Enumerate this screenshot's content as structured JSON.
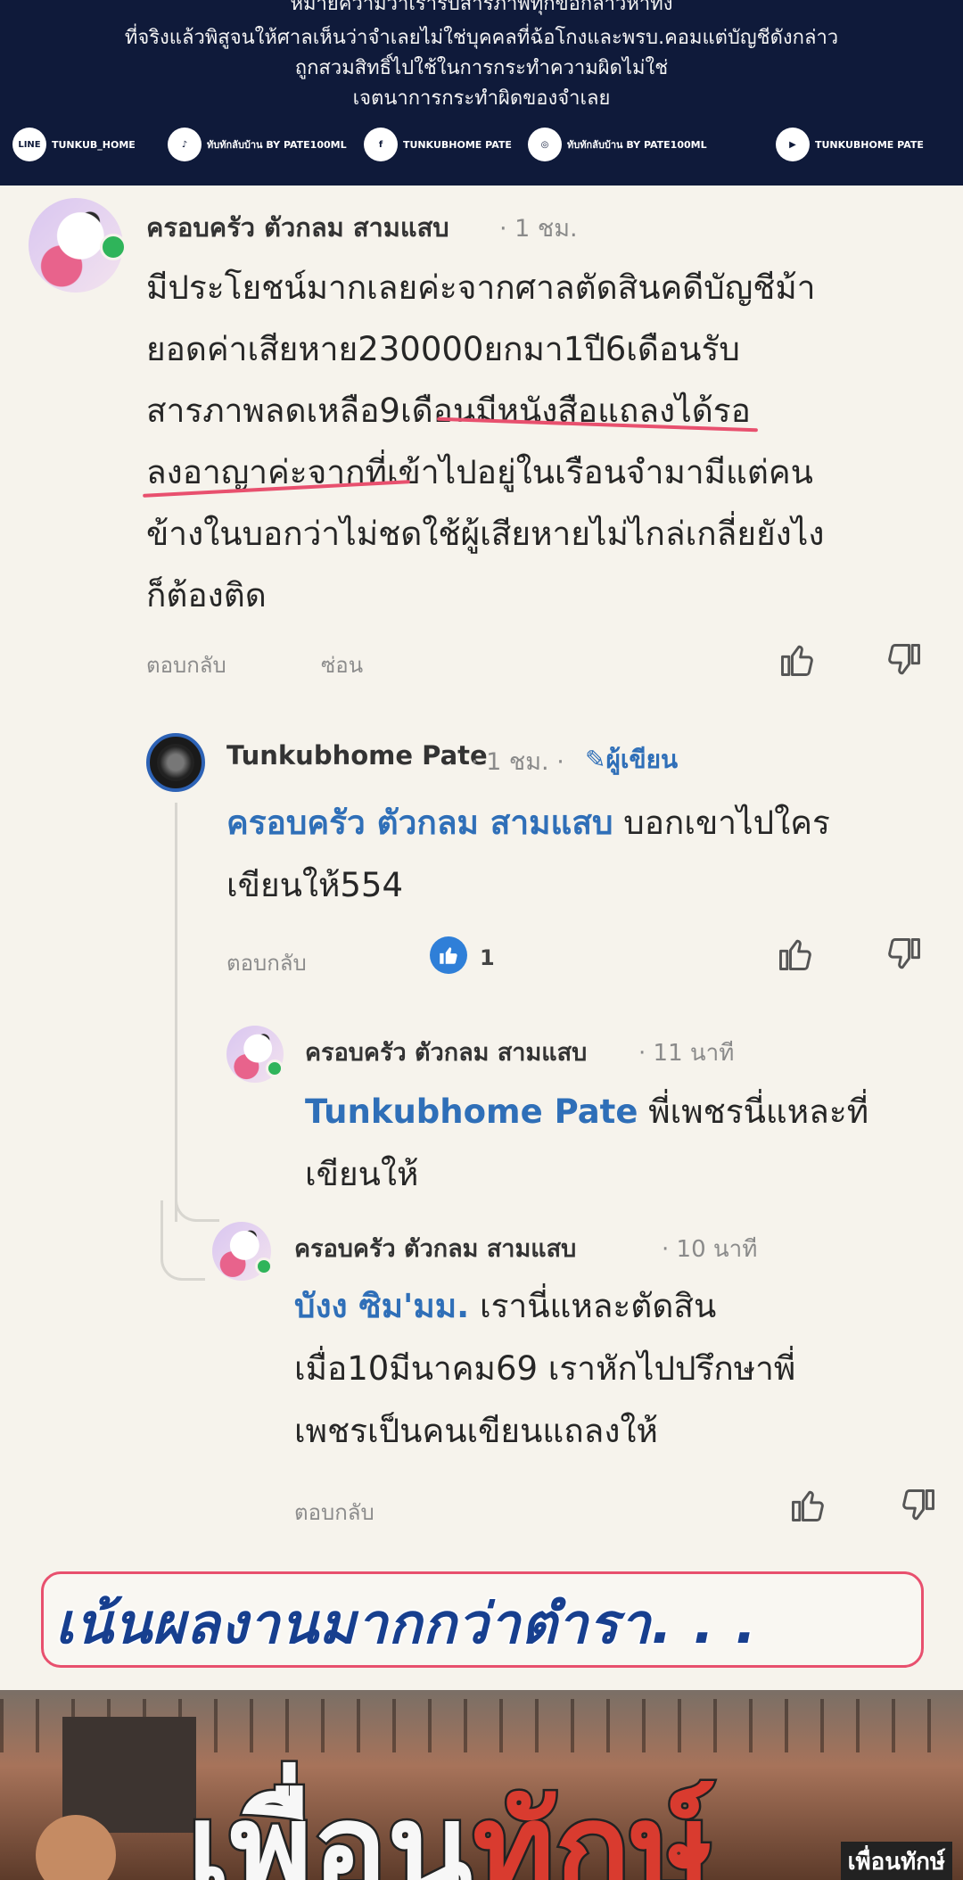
{
  "banner": {
    "lines": [
      "หมายความว่าเรารับสารภาพทุกข้อกล่าวหาทั้ง",
      "ที่จริงแล้วพิสูจนให้ศาลเห็นว่าจำเลยไม่ใช่บุคคลที่ฉ้อโกงและพรบ.คอมแต่บัญชีดังกล่าว",
      "ถูกสวมสิทธิ์ไปใช้ในการกระทำความผิดไม่ใช่",
      "เจตนาการกระทำผิดของจำเลย"
    ],
    "socials": [
      {
        "icon": "LINE",
        "label": "TUNKUB_HOME"
      },
      {
        "icon": "♪",
        "label": "ทับทักลับบ้าน BY PATE100ML"
      },
      {
        "icon": "f",
        "label": "TUNKUBHOME PATE"
      },
      {
        "icon": "◎",
        "label": "ทับทักลับบ้าน BY PATE100ML"
      },
      {
        "icon": "▶",
        "label": "TUNKUBHOME PATE"
      }
    ]
  },
  "comment1": {
    "author": "ครอบครัว ตัวกลม สามแสบ",
    "time": "· 1 ชม.",
    "lines": [
      "มีประโยชน์มากเลยค่ะจากศาลตัดสินคดีบัญชีม้า",
      "ยอดค่าเสียหาย230000ยกมา1ปี6เดือนรับ",
      "สารภาพลดเหลือ9เดือนมีหนังสือแถลงได้รอ",
      "ลงอาญาค่ะจากที่เข้าไปอยู่ในเรือนจำมามีแต่คน",
      "ข้างในบอกว่าไม่ชดใช้ผู้เสียหายไม่ไกล่เกลี่ยยังไง",
      "ก็ต้องติด"
    ],
    "reply_label": "ตอบกลับ",
    "hide_label": "ซ่อน"
  },
  "comment2": {
    "author": "Tunkubhome Pate",
    "time": "· 1 ชม. ·",
    "author_badge": "ผู้เขียน",
    "mention": "ครอบครัว ตัวกลม สามแสบ",
    "text_line1": "บอกเขาไปใคร",
    "text_line2": "เขียนให้554",
    "reply_label": "ตอบกลับ",
    "like_count": "1"
  },
  "comment3": {
    "author": "ครอบครัว ตัวกลม สามแสบ",
    "time": "· 11 นาที",
    "mention": "Tunkubhome Pate",
    "text_line1": "พี่เพชรนี่แหละที่",
    "text_line2": "เขียนให้"
  },
  "comment4": {
    "author": "ครอบครัว ตัวกลม สามแสบ",
    "time": "· 10 นาที",
    "mention": "บังง ซิม'มม.",
    "text_line1": "เรานี่แหละตัดสิน",
    "text_line2": "เมื่อ10มีนาคม69 เราหักไปปรึกษาพี่",
    "text_line3": "เพชรเป็นคนเขียนแถลงให้",
    "reply_label": "ตอบกลับ"
  },
  "caption": {
    "text": "เน้นผลงานมากกว่าตำรา. . ."
  },
  "poster": {
    "title_white": "เพื่อน",
    "title_red": "ทักษ์",
    "logo_text": "เพื่อนทักษ์"
  },
  "colors": {
    "banner_bg": "#0f1a3a",
    "mention": "#2f6fb8",
    "underline": "#e8506e",
    "online": "#2fb45a",
    "like_blue": "#2f7fd8"
  }
}
